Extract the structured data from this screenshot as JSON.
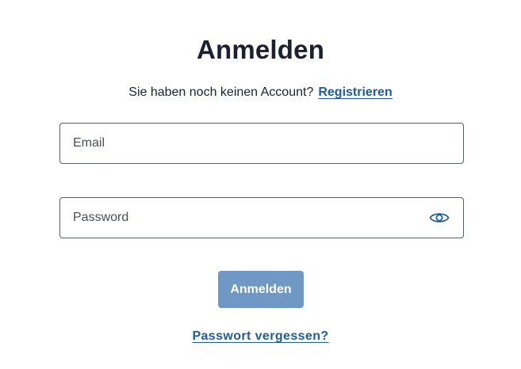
{
  "login": {
    "title": "Anmelden",
    "no_account_text": "Sie haben noch keinen Account?",
    "register_link": "Registrieren",
    "email": {
      "placeholder": "Email",
      "value": ""
    },
    "password": {
      "placeholder": "Password",
      "value": "",
      "toggle_icon": "eye-icon"
    },
    "submit_label": "Anmelden",
    "forgot_link": "Passwort vergessen?"
  },
  "colors": {
    "heading": "#1b2033",
    "link": "#1f5c99",
    "button_bg": "#6f98c4",
    "button_text": "#ffffff",
    "field_border": "#5b5f6b",
    "icon": "#1f5c99"
  }
}
